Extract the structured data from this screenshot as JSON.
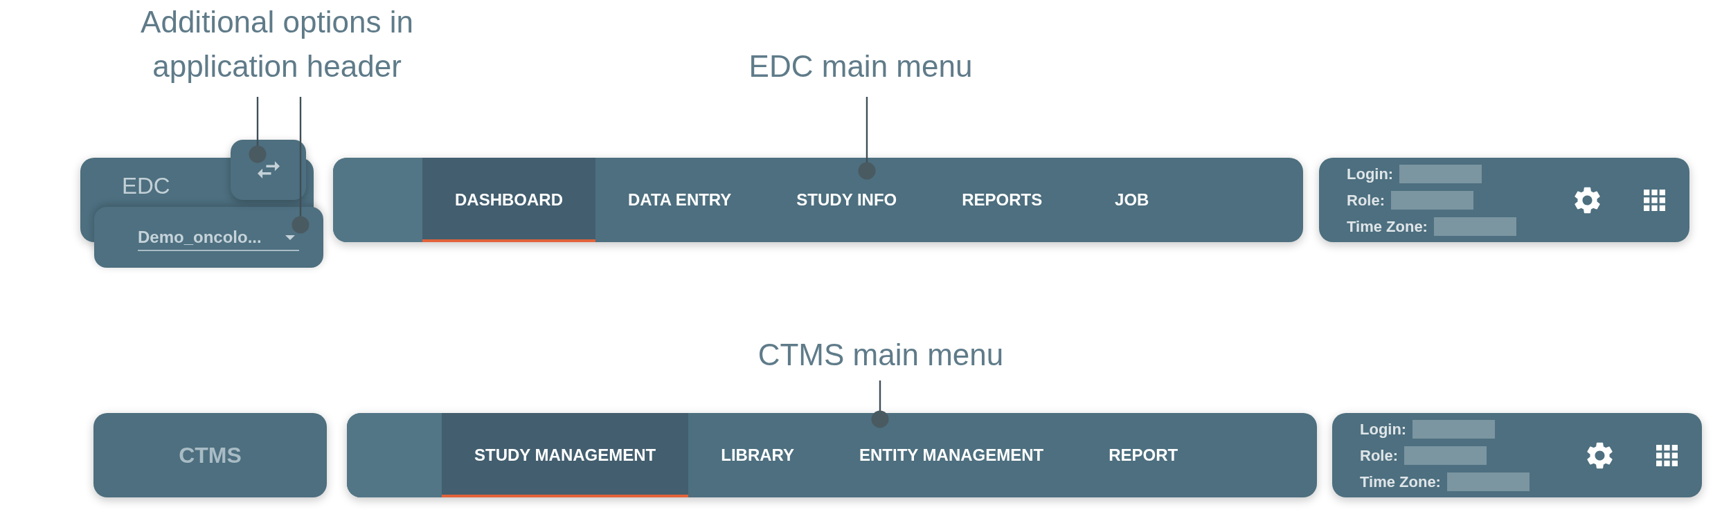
{
  "headers": [
    {
      "options_annotation": "Additional options in application header",
      "menu_annotation": "EDC main menu",
      "app_name": "EDC",
      "options": [
        {
          "kind": "switch"
        },
        {
          "kind": "select",
          "value": "Demo_oncolo..."
        }
      ],
      "menu": [
        {
          "label": "DASHBOARD",
          "selected": true
        },
        {
          "label": "DATA ENTRY",
          "selected": false
        },
        {
          "label": "STUDY INFO",
          "selected": false
        },
        {
          "label": "REPORTS",
          "selected": false
        },
        {
          "label": "JOB",
          "selected": false
        }
      ],
      "user_info": [
        {
          "label": "Login:",
          "redacted": true
        },
        {
          "label": "Role:",
          "redacted": true
        },
        {
          "label": "Time Zone:",
          "redacted": true
        }
      ]
    },
    {
      "menu_annotation": "CTMS main menu",
      "app_name": "CTMS",
      "menu": [
        {
          "label": "STUDY MANAGEMENT",
          "selected": true
        },
        {
          "label": "LIBRARY",
          "selected": false
        },
        {
          "label": "ENTITY MANAGEMENT",
          "selected": false
        },
        {
          "label": "REPORT",
          "selected": false
        }
      ],
      "user_info": [
        {
          "label": "Login:",
          "redacted": true
        },
        {
          "label": "Role:",
          "redacted": true
        },
        {
          "label": "Time Zone:",
          "redacted": true
        }
      ]
    }
  ]
}
